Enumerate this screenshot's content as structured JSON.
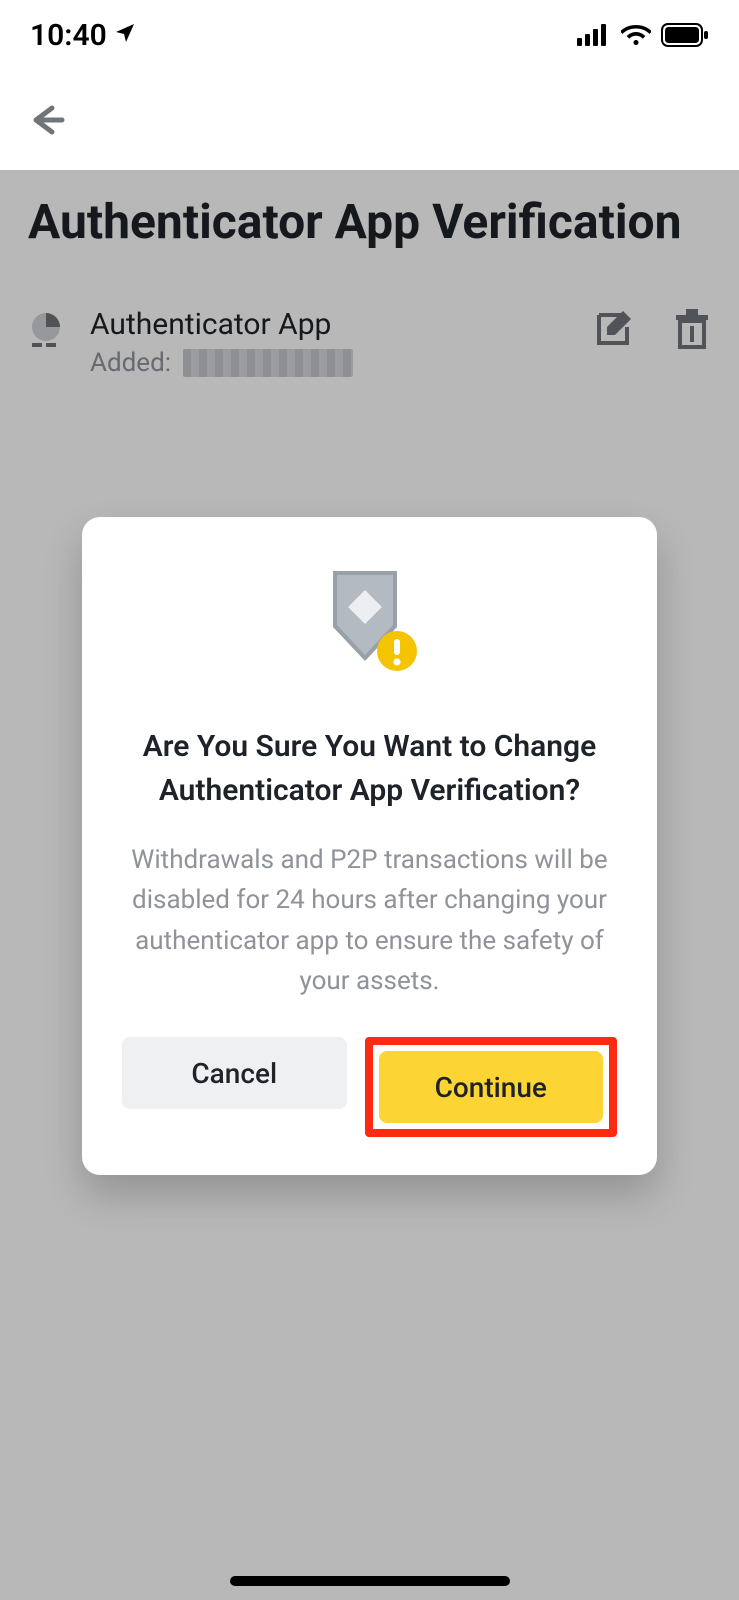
{
  "status": {
    "time": "10:40"
  },
  "page": {
    "title": "Authenticator App Verification",
    "item": {
      "name": "Authenticator App",
      "added_prefix": "Added:"
    }
  },
  "dialog": {
    "title": "Are You Sure You Want to Change Authenticator App Verification?",
    "body": "Withdrawals and P2P transactions will be disabled for 24 hours after changing your authenticator app to ensure the safety of your assets.",
    "cancel": "Cancel",
    "continue": "Continue"
  },
  "colors": {
    "accent": "#fcd535",
    "highlight_border": "#ff2a12",
    "text_primary": "#1e2329",
    "text_secondary": "#8f9399"
  }
}
